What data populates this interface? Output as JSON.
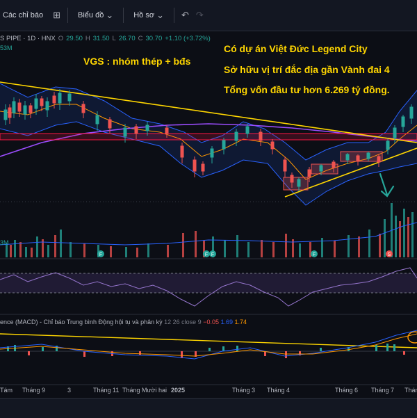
{
  "toolbar": {
    "indicators_label": "Các chỉ báo",
    "chart_type_label": "Biểu đồ",
    "profile_label": "Hồ sơ"
  },
  "legend": {
    "symbol": "S PIPE · 1D · HNX",
    "open": "29.50",
    "high": "31.50",
    "low": "26.70",
    "close": "30.70",
    "change": "+1.10 (+3.72%)",
    "volume_label": "53M"
  },
  "annotations": {
    "group": "VGS : nhóm thép + bđs",
    "line1": "Có dự án Việt Đức Legend City",
    "line2": "Sở hữu vị trí đắc địa gần Vành đai 4",
    "line3": "Tổng vốn đầu tư hơn 6.269 tỷ đồng."
  },
  "volume_legend": "3M",
  "macd": {
    "title": "ence (MACD) - Chỉ báo Trung bình Động hội tụ và phân kỳ",
    "params": "12 26 close 9",
    "hist": "−0.05",
    "macd": "1.69",
    "signal": "1.74"
  },
  "xaxis": [
    "Tám",
    "Tháng 9",
    "3",
    "Tháng 11",
    "Tháng Mười hai",
    "2025",
    "Tháng 3",
    "Tháng 4",
    "Tháng 6",
    "Tháng 7",
    "Tháng"
  ],
  "colors": {
    "up": "#26a69a",
    "down": "#ef5350",
    "trend": "#ffd600",
    "annotation": "#ffd600",
    "ma_long": "#9c4dff",
    "bollinger": "#2962ff",
    "resistance": "#ff1744"
  }
}
